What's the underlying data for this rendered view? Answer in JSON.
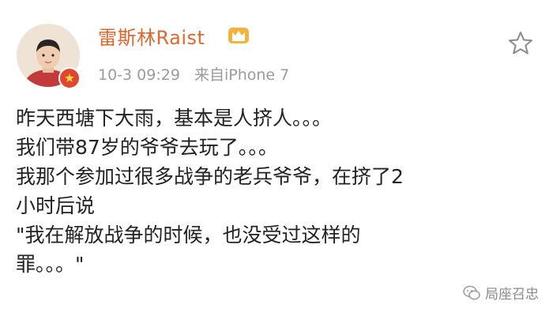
{
  "post": {
    "author": {
      "name": "雷斯林Raist"
    },
    "timestamp": "10-3 09:29",
    "source": "来自iPhone 7",
    "lines": [
      "昨天西塘下大雨，基本是人挤人。。。",
      "我们带87岁的爷爷去玩了。。。",
      "我那个参加过很多战争的老兵爷爷，在挤了2",
      "小时后说",
      "\"我在解放战争的时候，也没受过这样的",
      "罪。。。\""
    ]
  },
  "watermark": {
    "text": "局座召忠"
  },
  "icons": {
    "vip": "crown-vip-icon",
    "favorite": "star-outline-icon",
    "verify": "verified-badge-icon",
    "wechat": "wechat-logo-icon"
  },
  "colors": {
    "username": "#e2662e",
    "meta": "#9b9b9b",
    "body_text": "#222222",
    "vip_gold": "#f3b23a",
    "verify_badge": "#e2462f",
    "background": "#ffffff"
  }
}
